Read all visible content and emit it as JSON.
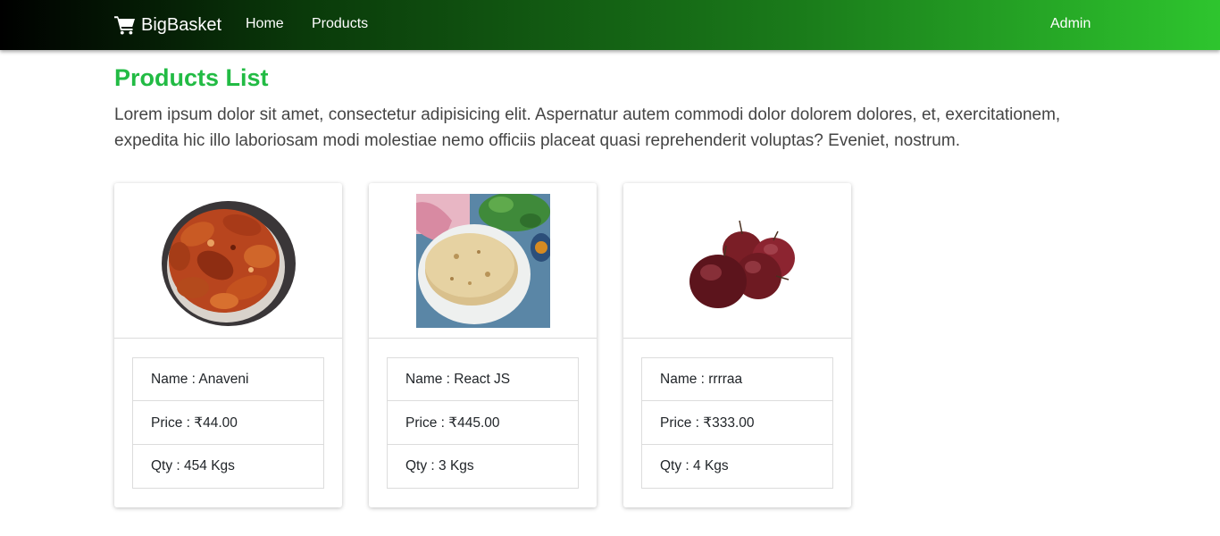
{
  "navbar": {
    "brand": "BigBasket",
    "links": [
      "Home",
      "Products"
    ],
    "admin": "Admin"
  },
  "page": {
    "title": "Products List",
    "description": "Lorem ipsum dolor sit amet, consectetur adipisicing elit. Aspernatur autem commodi dolor dolorem dolores, et, exercitationem, expedita hic illo laboriosam modi molestiae nemo officiis placeat quasi reprehenderit voluptas? Eveniet, nostrum."
  },
  "products": [
    {
      "name": "Name : Anaveni",
      "price": "Price : ₹44.00",
      "qty": "Qty : 454 Kgs",
      "image": "chicken-wings-image"
    },
    {
      "name": "Name : React JS",
      "price": "Price : ₹445.00",
      "qty": "Qty : 3 Kgs",
      "image": "chapati-image"
    },
    {
      "name": "Name : rrrraa",
      "price": "Price : ₹333.00",
      "qty": "Qty : 4 Kgs",
      "image": "apples-image"
    }
  ],
  "colors": {
    "accent": "#22bb44",
    "navbar_start": "#000000",
    "navbar_end": "#2ec52e"
  },
  "icons": {
    "brand": "shopping-cart-icon"
  }
}
